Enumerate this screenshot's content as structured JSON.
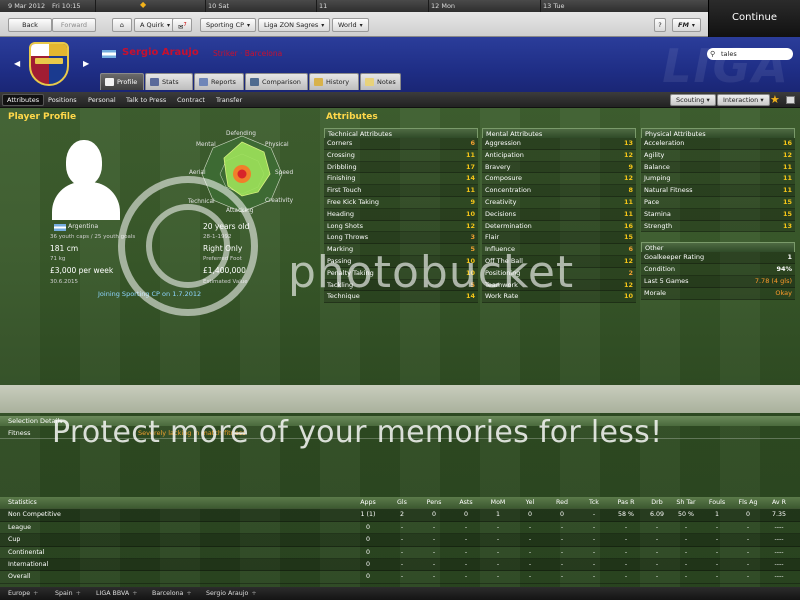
{
  "topbar": {
    "date": "9 Mar 2012",
    "time": "Fri 10:15",
    "cal_days": [
      "10 Sat",
      "11",
      "12 Mon",
      "13 Tue"
    ],
    "back_label": "Back",
    "forward_label": "Forward",
    "quick_label": "A Quirk",
    "mail_badge": "7",
    "team_label": "Sporting CP",
    "league_label": "Liga ZON Sagres",
    "world_label": "World",
    "help_label": "?",
    "fm_label": "FM",
    "continue_label": "Continue"
  },
  "header": {
    "player_name": "Sergio Araujo",
    "player_position": "Striker · Barcelona",
    "search_value": "tales",
    "watermark": "LIGA"
  },
  "tabs": [
    {
      "label": "Profile",
      "active": true
    },
    {
      "label": "Stats",
      "active": false
    },
    {
      "label": "Reports",
      "active": false
    },
    {
      "label": "Comparison",
      "active": false
    },
    {
      "label": "History",
      "active": false
    },
    {
      "label": "Notes",
      "active": false
    }
  ],
  "subnav": {
    "items": [
      "Attributes",
      "Positions",
      "Personal",
      "Talk to Press",
      "Contract",
      "Transfer"
    ],
    "scouting_label": "Scouting",
    "interaction_label": "Interaction"
  },
  "profile": {
    "title": "Player Profile",
    "nation": "Argentina",
    "caps": "36 youth caps / 25 youth goals",
    "age": "20 years old",
    "dob": "28-1-1992",
    "height": "181 cm",
    "weight": "71 kg",
    "foot": "Right Only",
    "foot_label": "Preferred Foot",
    "wage": "£3,000 per week",
    "contract": "30.6.2015",
    "value": "£1,400,000",
    "value_label": "Estimated Value",
    "joining": "Joining Sporting CP on 1.7.2012",
    "radar_labels": [
      "Defending",
      "Physical",
      "Speed",
      "Creativity",
      "Attacking",
      "Technical",
      "Aerial",
      "Mental"
    ]
  },
  "attributes": {
    "title": "Attributes",
    "technical": {
      "header": "Technical Attributes",
      "rows": [
        [
          "Corners",
          "6"
        ],
        [
          "Crossing",
          "11"
        ],
        [
          "Dribbling",
          "17"
        ],
        [
          "Finishing",
          "14"
        ],
        [
          "First Touch",
          "11"
        ],
        [
          "Free Kick Taking",
          "9"
        ],
        [
          "Heading",
          "10"
        ],
        [
          "Long Shots",
          "12"
        ],
        [
          "Long Throws",
          "3"
        ],
        [
          "Marking",
          "5"
        ],
        [
          "Passing",
          "10"
        ],
        [
          "Penalty Taking",
          "10"
        ],
        [
          "Tackling",
          "5"
        ],
        [
          "Technique",
          "14"
        ]
      ]
    },
    "mental": {
      "header": "Mental Attributes",
      "rows": [
        [
          "Aggression",
          "13"
        ],
        [
          "Anticipation",
          "12"
        ],
        [
          "Bravery",
          "9"
        ],
        [
          "Composure",
          "12"
        ],
        [
          "Concentration",
          "8"
        ],
        [
          "Creativity",
          "11"
        ],
        [
          "Decisions",
          "11"
        ],
        [
          "Determination",
          "16"
        ],
        [
          "Flair",
          "15"
        ],
        [
          "Influence",
          "6"
        ],
        [
          "Off The Ball",
          "12"
        ],
        [
          "Positioning",
          "2"
        ],
        [
          "Teamwork",
          "12"
        ],
        [
          "Work Rate",
          "10"
        ]
      ]
    },
    "physical": {
      "header": "Physical Attributes",
      "rows": [
        [
          "Acceleration",
          "16"
        ],
        [
          "Agility",
          "12"
        ],
        [
          "Balance",
          "11"
        ],
        [
          "Jumping",
          "11"
        ],
        [
          "Natural Fitness",
          "11"
        ],
        [
          "Pace",
          "15"
        ],
        [
          "Stamina",
          "15"
        ],
        [
          "Strength",
          "13"
        ]
      ]
    },
    "other": {
      "header": "Other",
      "rows": [
        [
          "Goalkeeper Rating",
          "1"
        ],
        [
          "Condition",
          "94%"
        ],
        [
          "Last 5 Games",
          "7.78 (4 gls)"
        ],
        [
          "Morale",
          "Okay"
        ]
      ]
    }
  },
  "selection": {
    "header": "Selection Details",
    "fitness_label": "Fitness",
    "fitness_note": "Severely lacking in match fitness"
  },
  "stats": {
    "columns": [
      "Statistics",
      "Apps",
      "Gls",
      "Pens",
      "Asts",
      "MoM",
      "Yel",
      "Red",
      "Tck",
      "Pas R",
      "Drb",
      "Sh Tar",
      "Fouls",
      "Fls Ag",
      "Av R"
    ],
    "rows": [
      [
        "Non Competitive",
        "1 (1)",
        "2",
        "0",
        "0",
        "1",
        "0",
        "0",
        "-",
        "58 %",
        "6.09",
        "50 %",
        "1",
        "0",
        "7.35"
      ],
      [
        "League",
        "0",
        "-",
        "-",
        "-",
        "-",
        "-",
        "-",
        "-",
        "-",
        "-",
        "-",
        "-",
        "-",
        "----"
      ],
      [
        "Cup",
        "0",
        "-",
        "-",
        "-",
        "-",
        "-",
        "-",
        "-",
        "-",
        "-",
        "-",
        "-",
        "-",
        "----"
      ],
      [
        "Continental",
        "0",
        "-",
        "-",
        "-",
        "-",
        "-",
        "-",
        "-",
        "-",
        "-",
        "-",
        "-",
        "-",
        "----"
      ],
      [
        "International",
        "0",
        "-",
        "-",
        "-",
        "-",
        "-",
        "-",
        "-",
        "-",
        "-",
        "-",
        "-",
        "-",
        "----"
      ],
      [
        "Overall",
        "0",
        "-",
        "-",
        "-",
        "-",
        "-",
        "-",
        "-",
        "-",
        "-",
        "-",
        "-",
        "-",
        "----"
      ]
    ]
  },
  "breadcrumbs": [
    "Europe",
    "Spain",
    "LIGA BBVA",
    "Barcelona",
    "Sergio Araujo"
  ],
  "watermark": {
    "brand": "photobucket",
    "tagline": "Protect more of your memories for less!"
  }
}
